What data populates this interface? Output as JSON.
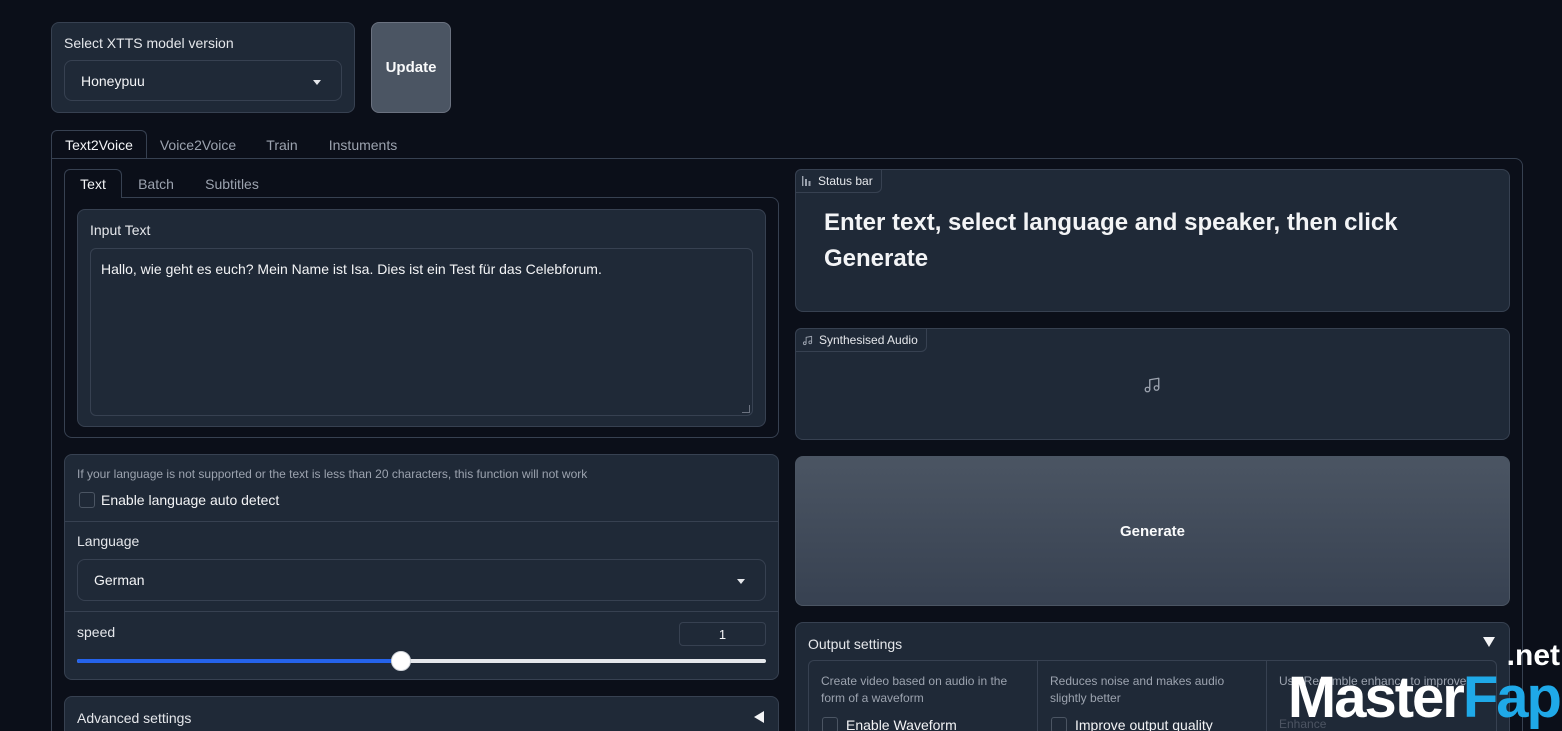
{
  "model_select": {
    "label": "Select XTTS model version",
    "value": "Honeypuu",
    "update_button": "Update"
  },
  "main_tabs": [
    {
      "label": "Text2Voice",
      "active": true
    },
    {
      "label": "Voice2Voice",
      "active": false
    },
    {
      "label": "Train",
      "active": false
    },
    {
      "label": "Instuments",
      "active": false
    }
  ],
  "sub_tabs": [
    {
      "label": "Text",
      "active": true
    },
    {
      "label": "Batch",
      "active": false
    },
    {
      "label": "Subtitles",
      "active": false
    }
  ],
  "input_text": {
    "label": "Input Text",
    "value": "Hallo, wie geht es euch? Mein Name ist Isa. Dies ist ein Test für das Celebforum."
  },
  "language_block": {
    "info": "If your language is not supported or the text is less than 20 characters, this function will not work",
    "auto_detect_label": "Enable language auto detect",
    "language_label": "Language",
    "language_value": "German"
  },
  "speed": {
    "label": "speed",
    "value": "1",
    "fraction": 0.47
  },
  "advanced_settings": {
    "label": "Advanced settings"
  },
  "status_bar": {
    "label": "Status bar",
    "message": "Enter text, select language and speaker, then click Generate"
  },
  "synth_audio": {
    "label": "Synthesised Audio"
  },
  "generate_button": "Generate",
  "output_settings": {
    "label": "Output settings",
    "columns": [
      {
        "info": "Create video based on audio in the form of a waveform",
        "checkbox_label": "Enable Waveform"
      },
      {
        "info": "Reduces noise and makes audio slightly better",
        "checkbox_label": "Improve output quality"
      },
      {
        "info": "Use Resemble enhance to improve",
        "checkbox_label": "Enhance"
      }
    ]
  },
  "watermark": {
    "part1": "Master",
    "part2": "Fap",
    "part3": ".net"
  },
  "colors": {
    "background": "#0b0f19",
    "panel": "#1f2937",
    "slider_accent": "#2563eb",
    "generate_button": "#4b5563"
  }
}
